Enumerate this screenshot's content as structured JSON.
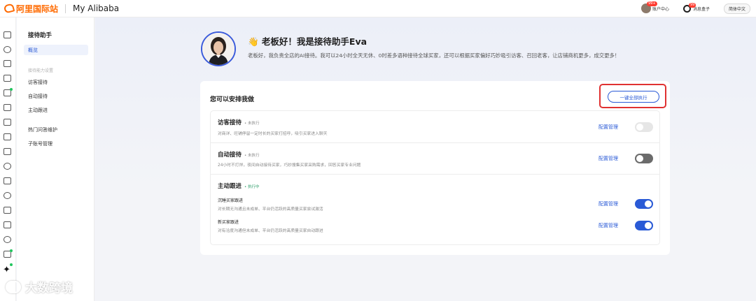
{
  "header": {
    "logo_text": "阿里国际站",
    "brand": "My Alibaba",
    "account_center": "账户中心",
    "account_badge": "99+",
    "messages": "消息盒子",
    "messages_badge": "99",
    "language": "简体中文"
  },
  "subnav": {
    "title": "接待助手",
    "active_item": "概览",
    "group_label": "接待能力设置",
    "items": [
      "访客接待",
      "自动接待",
      "主动跟进"
    ],
    "other_items": [
      "热门问答维护",
      "子账号管理"
    ]
  },
  "hero": {
    "title": "👋 老板好！我是接待助手Eva",
    "description": "老板好，我负责全店的AI接待。我可以24小时全天无休、0时差多语种接待全球买家，还可以根据买家偏好巧妙吸引访客、召回老客，让店铺商机更多，成交更多！"
  },
  "tasks_card": {
    "title": "您可以安排我做",
    "run_all_label": "一键全部执行",
    "config_label": "配置管理",
    "tasks": [
      {
        "name": "访客接待",
        "status": "• 未执行",
        "description": "对商详、旺铺停留一定时长的买家打招呼，吸引买家进入聊天",
        "toggle": "off-disabled"
      },
      {
        "name": "自动接待",
        "status": "• 未执行",
        "description": "24小时不打烊，夜间自动接待买家，巧妙搜集买家采购需求，回答买家专业问题",
        "toggle": "off"
      },
      {
        "name": "主动跟进",
        "status": "• 执行中",
        "subtasks": [
          {
            "name": "沉睡买家跟进",
            "description": "对长期无沟通且未成单、平台仍活跃的高质量买家尝试激活",
            "toggle": "on"
          },
          {
            "name": "新买家跟进",
            "description": "对有洽度沟通但未成单、平台仍活跃的高质量买家自动跟进",
            "toggle": "on"
          }
        ]
      }
    ]
  },
  "watermark": "大数跨境",
  "colors": {
    "brand_orange": "#ff6a00",
    "accent_blue": "#2a5ad6",
    "highlight_red": "#e03131",
    "active_green": "#2f9e6a"
  }
}
